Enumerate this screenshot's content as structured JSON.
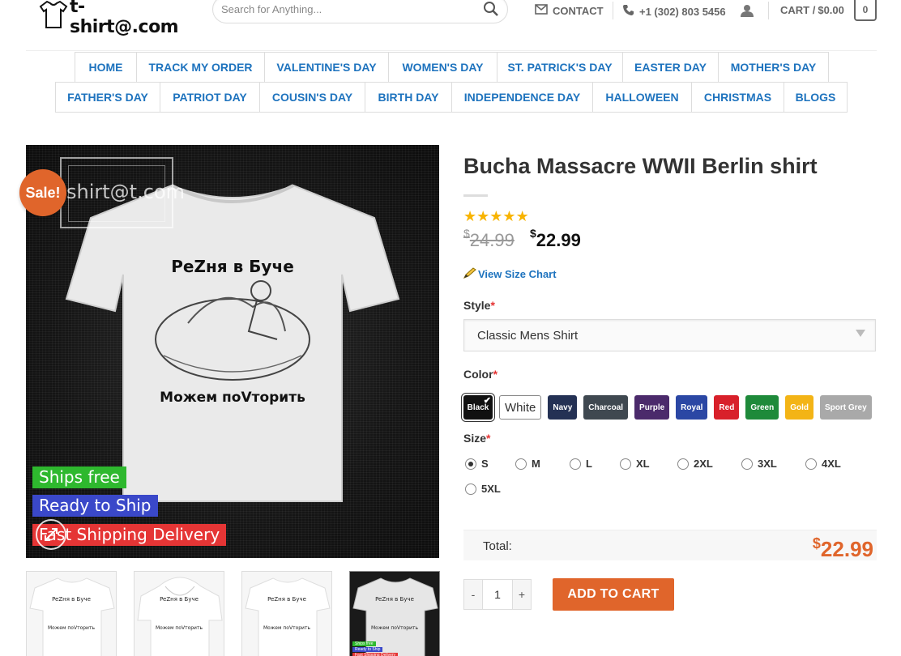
{
  "header": {
    "logo_text": "t-shirt@.com",
    "search_placeholder": "Search for Anything...",
    "contact_label": "CONTACT",
    "phone_label": "+1 (302) 803 5456",
    "cart_label": "CART /",
    "cart_total": "$0.00",
    "cart_count": "0"
  },
  "nav": {
    "row1": [
      "HOME",
      "TRACK MY ORDER",
      "VALENTINE'S DAY",
      "WOMEN'S DAY",
      "ST. PATRICK'S DAY",
      "EASTER DAY",
      "MOTHER'S DAY"
    ],
    "row2": [
      "FATHER'S DAY",
      "PATRIOT DAY",
      "COUSIN'S DAY",
      "BIRTH DAY",
      "INDEPENDENCE DAY",
      "HALLOWEEN",
      "CHRISTMAS",
      "BLOGS"
    ]
  },
  "gallery": {
    "sale_badge": "Sale!",
    "watermark": "shirt@t.com",
    "shirt_top_text": "PeZня в Буче",
    "shirt_bottom_text": "Можем поVторить",
    "tag_ships_free": "Ships free",
    "tag_ready": "Ready to Ship",
    "tag_fast": "Fast Shipping Delivery"
  },
  "product": {
    "title": "Bucha Massacre WWII Berlin shirt",
    "rating": 5,
    "price_old_symbol": "$",
    "price_old": "24.99",
    "price_new_symbol": "$",
    "price_new": "22.99",
    "size_chart_label": "View Size Chart",
    "style_label": "Style",
    "style_value": "Classic Mens Shirt",
    "color_label": "Color",
    "colors": [
      {
        "name": "Black",
        "hex": "#111111",
        "selected": true
      },
      {
        "name": "White",
        "hex": "#ffffff"
      },
      {
        "name": "Navy",
        "hex": "#243154"
      },
      {
        "name": "Charcoal",
        "hex": "#3f4850"
      },
      {
        "name": "Purple",
        "hex": "#4b2a6b"
      },
      {
        "name": "Royal",
        "hex": "#2b47a4"
      },
      {
        "name": "Red",
        "hex": "#d8202a"
      },
      {
        "name": "Green",
        "hex": "#1e8a3a"
      },
      {
        "name": "Gold",
        "hex": "#f3b416"
      },
      {
        "name": "Sport Grey",
        "hex": "#a9a9a9"
      }
    ],
    "size_label": "Size",
    "sizes": [
      "S",
      "M",
      "L",
      "XL",
      "2XL",
      "3XL",
      "4XL",
      "5XL"
    ],
    "selected_size": "S",
    "total_label": "Total:",
    "total_symbol": "$",
    "total_value": "22.99",
    "qty_minus": "-",
    "qty_plus": "+",
    "qty_value": "1",
    "add_to_cart": "ADD TO CART",
    "required_mark": "*"
  }
}
